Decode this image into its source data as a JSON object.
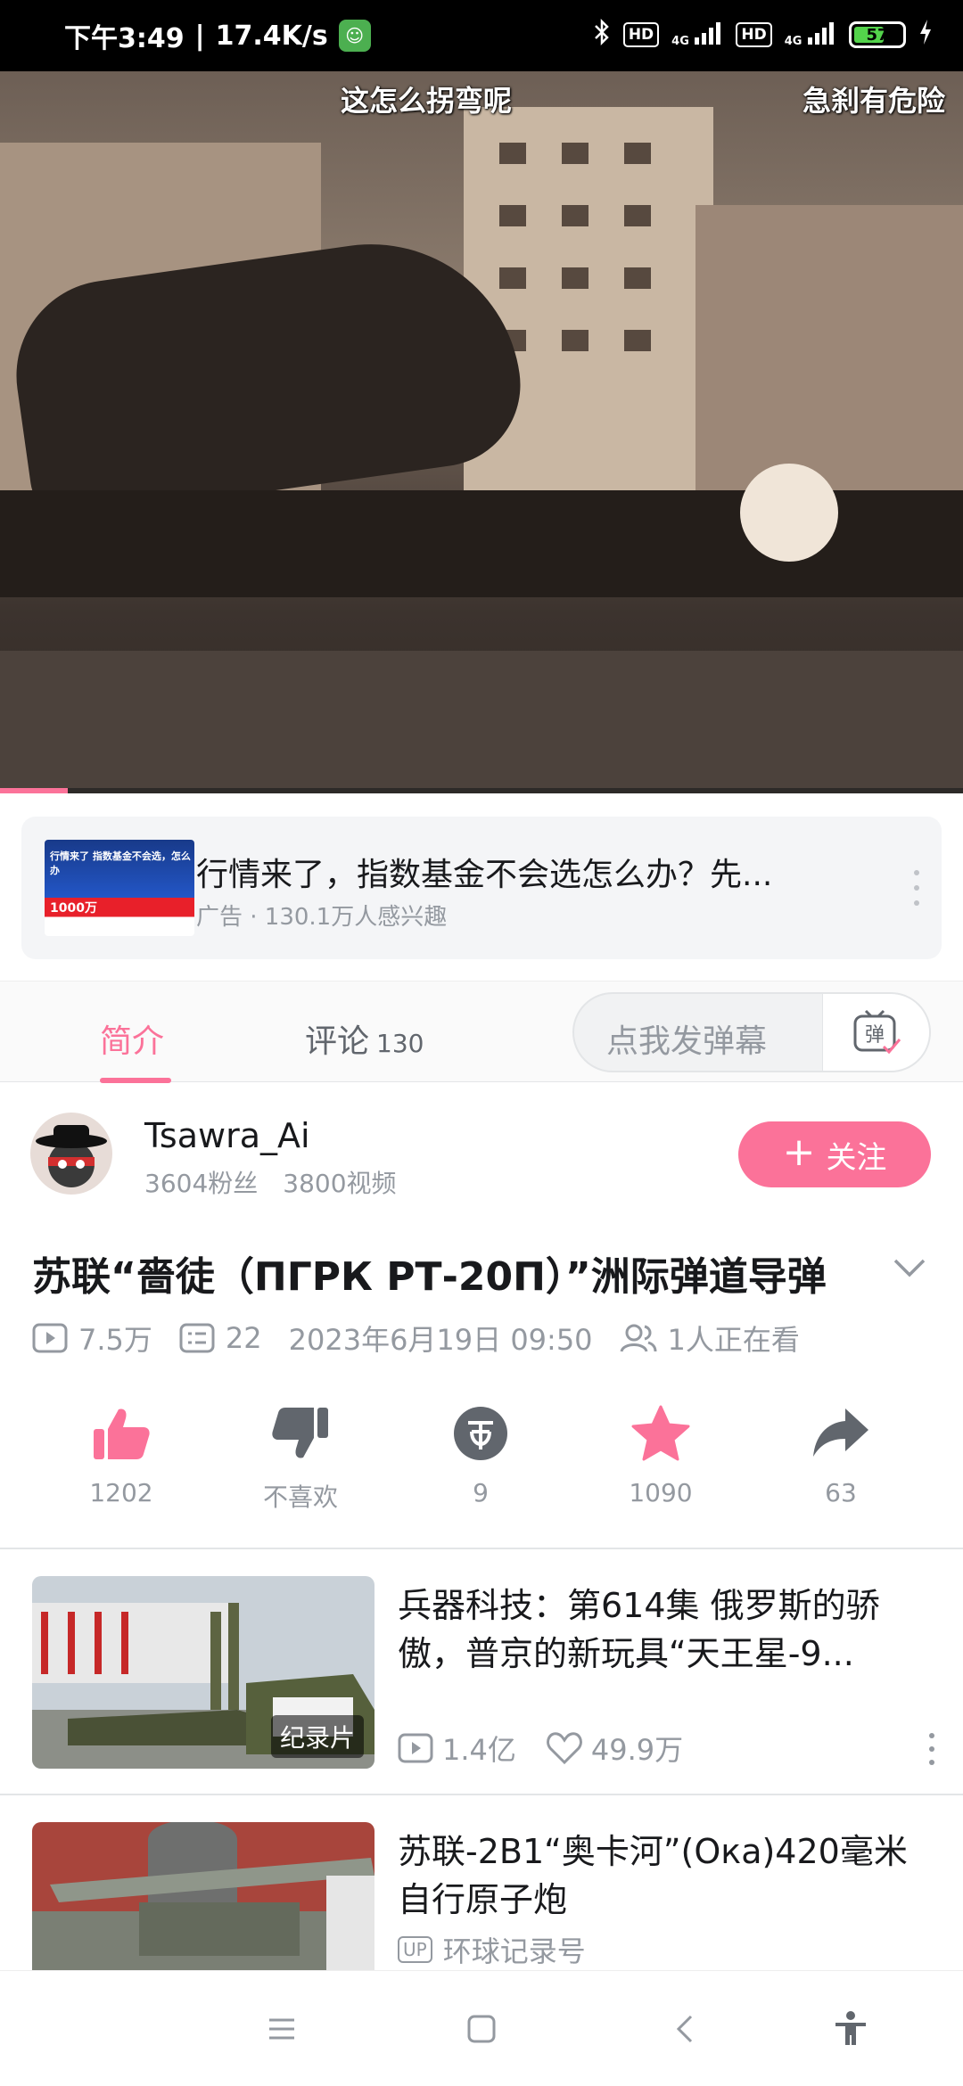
{
  "status_bar": {
    "time": "下午3:49",
    "net_speed": "17.4K/s",
    "hd1": "HD",
    "hd2": "HD",
    "net1": "4G",
    "net2": "4G",
    "battery": "57"
  },
  "video": {
    "danmaku": [
      "这怎么拐弯呢",
      "急刹有危险"
    ],
    "progress": 0.07
  },
  "ad": {
    "title": "行情来了，指数基金不会选怎么办？先...",
    "subtitle": "广告 · 130.1万人感兴趣",
    "thumb_headline": "行情来了 指数基金不会选，怎么办",
    "thumb_big": "1000万"
  },
  "tabs": {
    "intro": "简介",
    "comments": "评论",
    "comments_count": "130",
    "danmaku_placeholder": "点我发弹幕",
    "danmaku_button": "弹"
  },
  "uploader": {
    "name": "Tsawra_Ai",
    "fans": "3604粉丝",
    "videos": "3800视频",
    "follow_label": "关注"
  },
  "video_info": {
    "title": "苏联“嗇徒（ПГРК РТ-20П）”洲际弹道导弹",
    "views": "7.5万",
    "danmaku_count": "22",
    "date": "2023年6月19日 09:50",
    "watching": "1人正在看"
  },
  "actions": [
    {
      "name": "like",
      "label": "1202"
    },
    {
      "name": "dislike",
      "label": "不喜欢"
    },
    {
      "name": "coin",
      "label": "9"
    },
    {
      "name": "favorite",
      "label": "1090"
    },
    {
      "name": "share",
      "label": "63"
    }
  ],
  "recommendations": [
    {
      "title": "兵器科技：第614集 俄罗斯的骄傲，普京的新玩具“天王星-9...",
      "badge": "纪录片",
      "views": "1.4亿",
      "likes": "49.9万"
    },
    {
      "title": "苏联-2B1“奥卡河”(Ока)420毫米自行原子炮",
      "uploader_tag": "UP",
      "uploader": "环球记录号"
    }
  ],
  "colors": {
    "accent": "#fb7299",
    "secondary_text": "#9499a0",
    "primary_text": "#18191c"
  }
}
